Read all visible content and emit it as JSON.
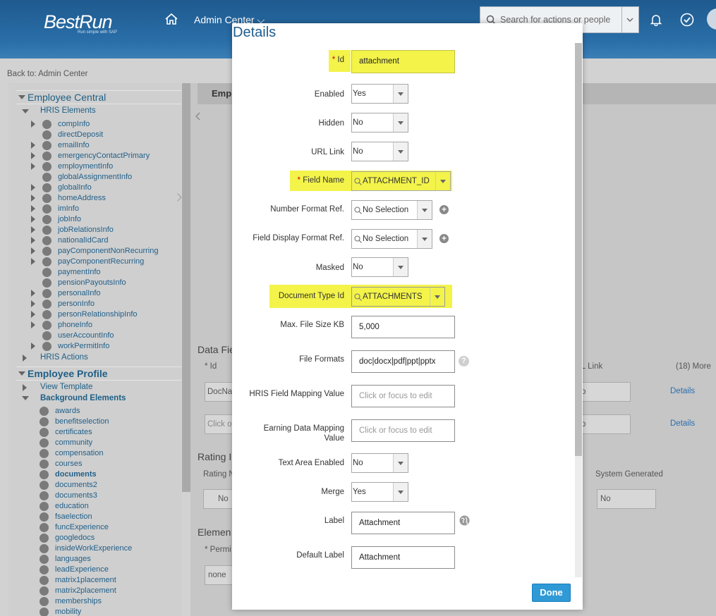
{
  "header": {
    "logo": "BestRun",
    "logo_tagline": "Run simple with SAP",
    "module": "Admin Center",
    "search_placeholder": "Search for actions or people"
  },
  "page": {
    "back_link": "Back to: Admin Center",
    "content_tab": "Emplo",
    "section_data_fields": "Data Fie",
    "col_id": "* Id",
    "col_url_link": "L Link",
    "col_more": "(18) More",
    "row1_id": "DocNa",
    "row2_id": "Click o",
    "row_select": "o",
    "details_link": "Details",
    "section_rating": "Rating I",
    "rating_name": "Rating N",
    "rating_value": "No",
    "system_generated": "System Generated",
    "system_generated_value": "No",
    "section_element": "Elemen",
    "permission_label": "* Permi",
    "permission_value": "none"
  },
  "tree": {
    "employee_central": "Employee Central",
    "hris_elements": "HRIS Elements",
    "hris_items": [
      "compInfo",
      "directDeposit",
      "emailInfo",
      "emergencyContactPrimary",
      "employmentInfo",
      "globalAssignmentInfo",
      "globalInfo",
      "homeAddress",
      "imInfo",
      "jobInfo",
      "jobRelationsInfo",
      "nationalIdCard",
      "payComponentNonRecurring",
      "payComponentRecurring",
      "paymentInfo",
      "pensionPayoutsInfo",
      "personalInfo",
      "personInfo",
      "personRelationshipInfo",
      "phoneInfo",
      "userAccountInfo",
      "workPermitInfo"
    ],
    "hris_actions": "HRIS Actions",
    "employee_profile": "Employee Profile",
    "view_template": "View Template",
    "background_elements": "Background Elements",
    "background_items": [
      "awards",
      "benefitselection",
      "certificates",
      "community",
      "compensation",
      "courses",
      "documents",
      "documents2",
      "documents3",
      "education",
      "fsaelection",
      "funcExperience",
      "googledocs",
      "insideWorkExperience",
      "languages",
      "leadExperience",
      "matrix1placement",
      "matrix2placement",
      "memberships",
      "mobility"
    ]
  },
  "dialog": {
    "title": "Details",
    "id_label": "Id",
    "id_value": "attachment",
    "enabled_label": "Enabled",
    "enabled_value": "Yes",
    "hidden_label": "Hidden",
    "hidden_value": "No",
    "url_link_label": "URL Link",
    "url_link_value": "No",
    "field_name_label": "Field Name",
    "field_name_value": "ATTACHMENT_ID",
    "number_format_label": "Number Format Ref.",
    "number_format_value": "No Selection",
    "field_display_label": "Field Display Format Ref.",
    "field_display_value": "No Selection",
    "masked_label": "Masked",
    "masked_value": "No",
    "doc_type_label": "Document Type Id",
    "doc_type_value": "ATTACHMENTS",
    "max_file_label": "Max. File Size KB",
    "max_file_value": "5,000",
    "file_formats_label": "File Formats",
    "file_formats_value": "doc|docx|pdf|ppt|pptx",
    "hris_mapping_label": "HRIS Field Mapping Value",
    "hris_mapping_placeholder": "Click or focus to edit",
    "earning_mapping_label_1": "Earning Data Mapping",
    "earning_mapping_label_2": "Value",
    "earning_mapping_placeholder": "Click or focus to edit",
    "text_area_label": "Text Area Enabled",
    "text_area_value": "No",
    "merge_label": "Merge",
    "merge_value": "Yes",
    "label_label": "Label",
    "label_value": "Attachment",
    "default_label_label": "Default Label",
    "default_label_value": "Attachment",
    "done_label": "Done",
    "required_mark": "*",
    "plus_icon": "+",
    "help_icon": "?"
  },
  "colors": {
    "header_blue": "#1e5a8e",
    "highlight": "#f3f34a",
    "done_button": "#2f9ad6",
    "required": "#d4000e"
  }
}
